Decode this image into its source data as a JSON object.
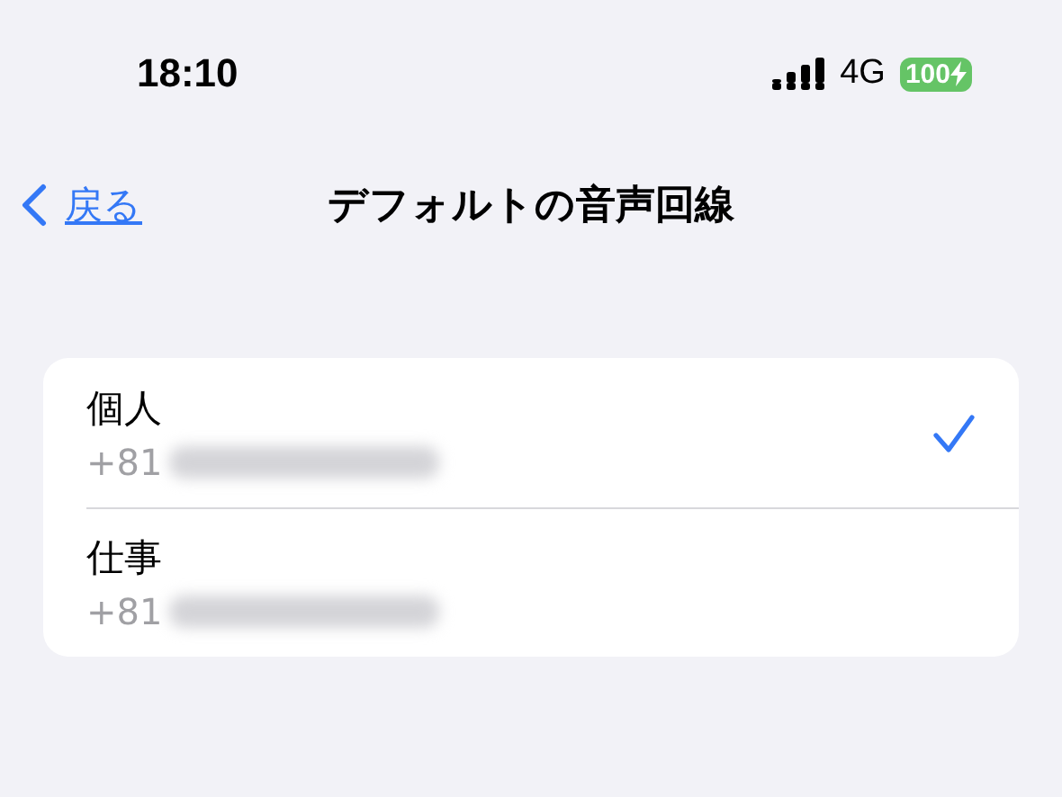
{
  "status_bar": {
    "time": "18:10",
    "network": "4G",
    "battery": "100"
  },
  "nav": {
    "back": "戻る",
    "title": "デフォルトの音声回線"
  },
  "lines": [
    {
      "name": "個人",
      "number": "+81",
      "selected": true
    },
    {
      "name": "仕事",
      "number": "+81",
      "selected": false
    }
  ]
}
